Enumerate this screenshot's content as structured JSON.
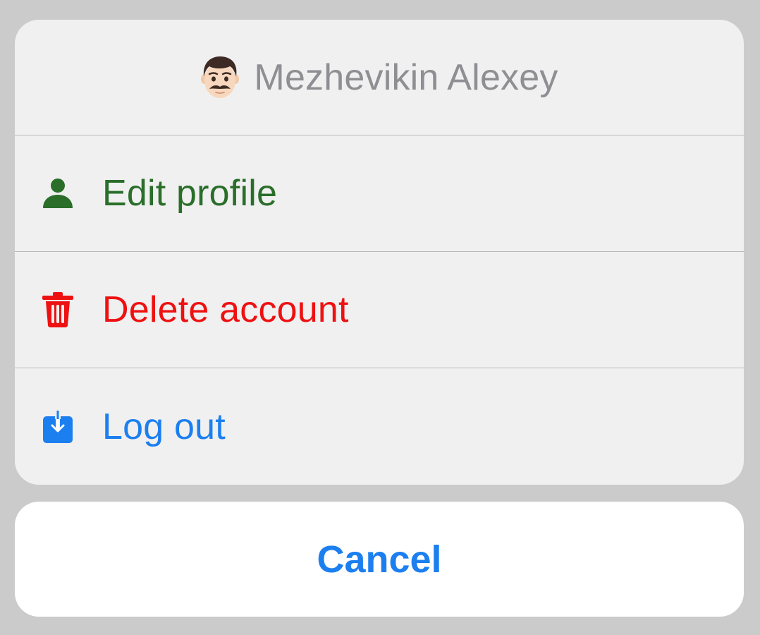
{
  "sheet": {
    "header": {
      "avatar_icon": "man-face-emoji-icon",
      "title": "Mezhevikin Alexey"
    },
    "actions": [
      {
        "label": "Edit profile",
        "icon": "person-icon",
        "color": "#2a6e2a"
      },
      {
        "label": "Delete account",
        "icon": "trash-icon",
        "color": "#ee1111"
      },
      {
        "label": "Log out",
        "icon": "tray-arrow-down-icon",
        "color": "#1c7ff0"
      }
    ]
  },
  "cancel": {
    "label": "Cancel",
    "color": "#1c7ff0"
  }
}
